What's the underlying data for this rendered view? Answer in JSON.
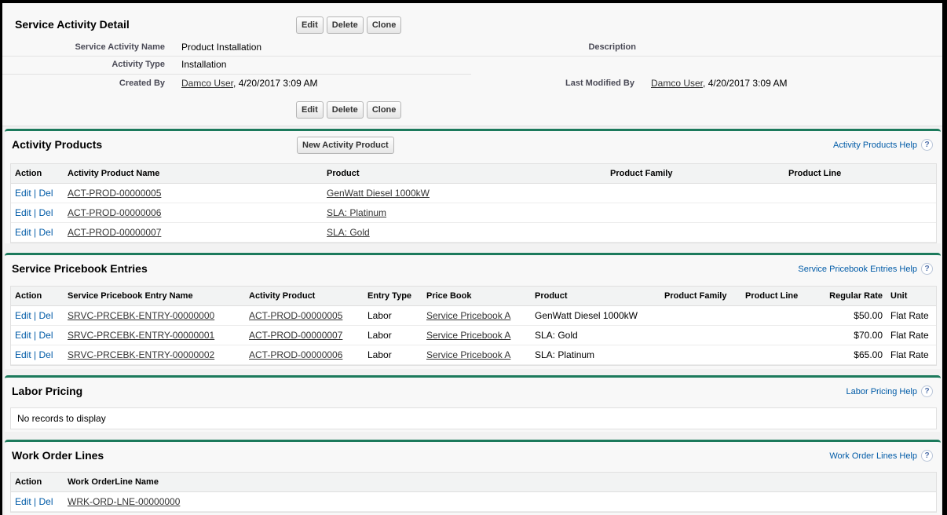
{
  "detail": {
    "title": "Service Activity Detail",
    "buttons": {
      "edit": "Edit",
      "delete": "Delete",
      "clone": "Clone"
    },
    "fields": {
      "name_label": "Service Activity Name",
      "name_value": "Product Installation",
      "type_label": "Activity Type",
      "type_value": "Installation",
      "created_label": "Created By",
      "created_user": "Damco User",
      "created_date": ", 4/20/2017 3:09 AM",
      "description_label": "Description",
      "modified_label": "Last Modified By",
      "modified_user": "Damco User",
      "modified_date": ", 4/20/2017 3:09 AM"
    }
  },
  "activity_products": {
    "title": "Activity Products",
    "new_button": "New Activity Product",
    "help": "Activity Products Help",
    "columns": [
      "Action",
      "Activity Product Name",
      "Product",
      "Product Family",
      "Product Line"
    ],
    "rows": [
      {
        "edit": "Edit",
        "sep": " | ",
        "del": "Del",
        "name": "ACT-PROD-00000005",
        "product": "GenWatt Diesel 1000kW",
        "family": "",
        "line": ""
      },
      {
        "edit": "Edit",
        "sep": " | ",
        "del": "Del",
        "name": "ACT-PROD-00000006",
        "product": "SLA: Platinum",
        "family": "",
        "line": ""
      },
      {
        "edit": "Edit",
        "sep": " | ",
        "del": "Del",
        "name": "ACT-PROD-00000007",
        "product": "SLA: Gold",
        "family": "",
        "line": ""
      }
    ]
  },
  "pricebook": {
    "title": "Service Pricebook Entries",
    "help": "Service Pricebook Entries Help",
    "columns": [
      "Action",
      "Service Pricebook Entry Name",
      "Activity Product",
      "Entry Type",
      "Price Book",
      "Product",
      "Product Family",
      "Product Line",
      "Regular Rate",
      "Unit"
    ],
    "rows": [
      {
        "edit": "Edit",
        "sep": " | ",
        "del": "Del",
        "name": "SRVC-PRCEBK-ENTRY-00000000",
        "activity": "ACT-PROD-00000005",
        "type": "Labor",
        "book": "Service Pricebook A",
        "product": "GenWatt Diesel 1000kW",
        "family": "",
        "line": "",
        "rate": "$50.00",
        "unit": "Flat Rate"
      },
      {
        "edit": "Edit",
        "sep": " | ",
        "del": "Del",
        "name": "SRVC-PRCEBK-ENTRY-00000001",
        "activity": "ACT-PROD-00000007",
        "type": "Labor",
        "book": "Service Pricebook A",
        "product": "SLA: Gold",
        "family": "",
        "line": "",
        "rate": "$70.00",
        "unit": "Flat Rate"
      },
      {
        "edit": "Edit",
        "sep": " | ",
        "del": "Del",
        "name": "SRVC-PRCEBK-ENTRY-00000002",
        "activity": "ACT-PROD-00000006",
        "type": "Labor",
        "book": "Service Pricebook A",
        "product": "SLA: Platinum",
        "family": "",
        "line": "",
        "rate": "$65.00",
        "unit": "Flat Rate"
      }
    ]
  },
  "labor": {
    "title": "Labor Pricing",
    "help": "Labor Pricing Help",
    "empty": "No records to display"
  },
  "work_order": {
    "title": "Work Order Lines",
    "help": "Work Order Lines Help",
    "columns": [
      "Action",
      "Work OrderLine Name"
    ],
    "rows": [
      {
        "edit": "Edit",
        "sep": " | ",
        "del": "Del",
        "name": "WRK-ORD-LNE-00000000"
      }
    ]
  },
  "help_icon": "question-circle-icon",
  "help_glyph": "?",
  "colors": {
    "section_accent": "#1c7a5c",
    "link_blue": "#015ba7",
    "background": "#f8f8f8"
  }
}
